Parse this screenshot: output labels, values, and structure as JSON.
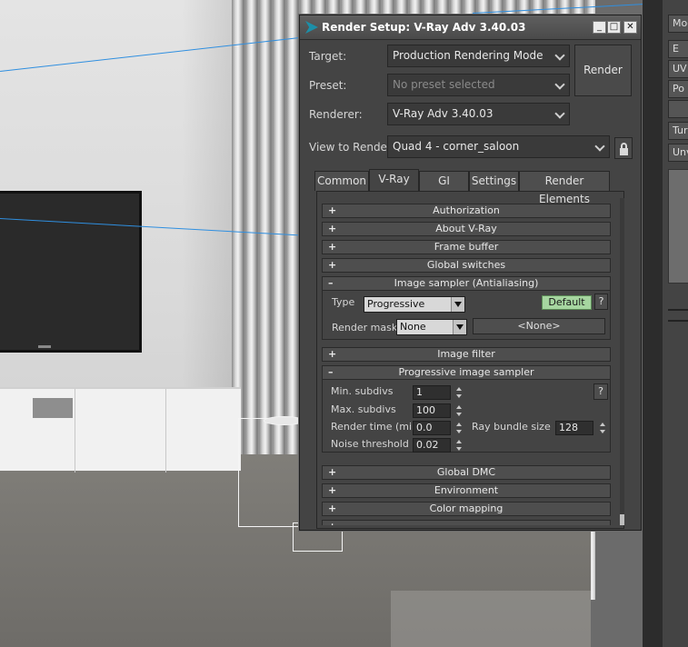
{
  "dialog": {
    "title": "Render Setup: V-Ray Adv 3.40.03",
    "target_label": "Target:",
    "target_value": "Production Rendering Mode",
    "preset_label": "Preset:",
    "preset_value": "No preset selected",
    "renderer_label": "Renderer:",
    "renderer_value": "V-Ray Adv 3.40.03",
    "view_label": "View to Render:",
    "view_value": "Quad 4 - corner_saloon",
    "render_button": "Render",
    "tabs": [
      "Common",
      "V-Ray",
      "GI",
      "Settings",
      "Render Elements"
    ],
    "active_tab": "V-Ray"
  },
  "rollouts": {
    "authorization": "Authorization",
    "about": "About V-Ray",
    "frame_buffer": "Frame buffer",
    "global_switches": "Global switches",
    "image_sampler": "Image sampler (Antialiasing)",
    "image_filter": "Image filter",
    "progressive": "Progressive image sampler",
    "global_dmc": "Global DMC",
    "environment": "Environment",
    "color_mapping": "Color mapping",
    "plus": "+",
    "minus": "–"
  },
  "image_sampler": {
    "type_label": "Type",
    "type_value": "Progressive",
    "default_button": "Default",
    "help": "?",
    "render_mask_label": "Render mask",
    "render_mask_value": "None",
    "mask_button": "<None>"
  },
  "progressive": {
    "min_subdivs_label": "Min. subdivs",
    "min_subdivs": "1",
    "max_subdivs_label": "Max. subdivs",
    "max_subdivs": "100",
    "render_time_label": "Render time (min)",
    "render_time": "0.0",
    "noise_threshold_label": "Noise threshold",
    "noise_threshold": "0.02",
    "ray_bundle_label": "Ray bundle size",
    "ray_bundle": "128",
    "help": "?"
  },
  "right_panel": {
    "items": [
      "Modi",
      "E",
      "UV",
      "Po",
      "Tur",
      "Unv"
    ]
  },
  "window_controls": {
    "minimize": "_",
    "maximize": "□",
    "close": "✕"
  },
  "colors": {
    "default_button": "#a6d6a0",
    "blue_line": "#2f8fe0",
    "app_icon": "#1c8fa8"
  }
}
